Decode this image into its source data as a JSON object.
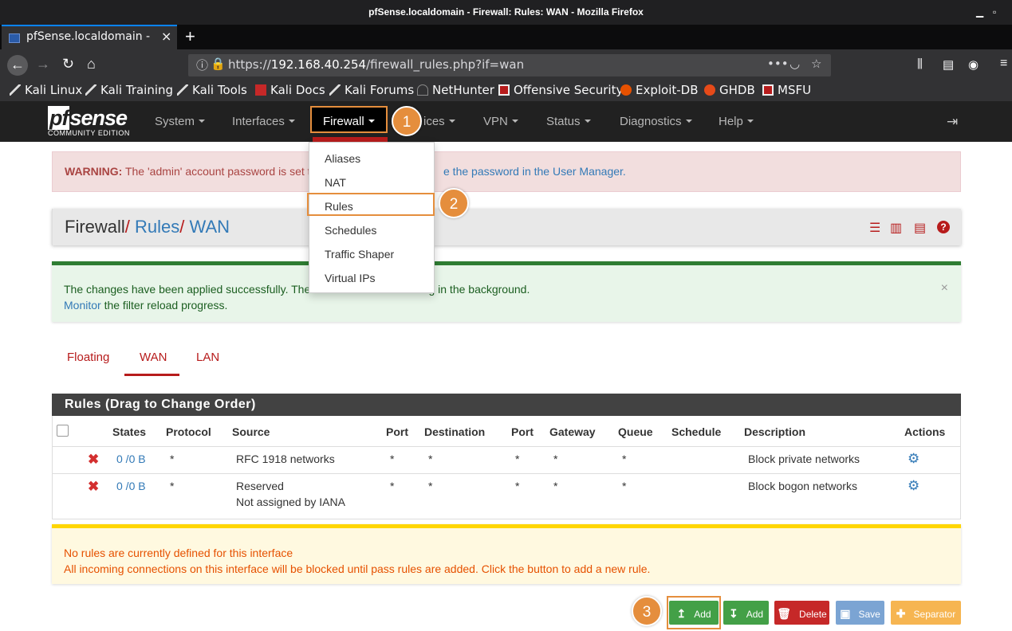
{
  "window": {
    "title": "pfSense.localdomain - Firewall: Rules: WAN - Mozilla Firefox"
  },
  "browser": {
    "tab_title": "pfSense.localdomain - Fi",
    "url_prefix": "https://",
    "url_host": "192.168.40.254",
    "url_path": "/firewall_rules.php?if=wan",
    "bookmarks": [
      "Kali Linux",
      "Kali Training",
      "Kali Tools",
      "Kali Docs",
      "Kali Forums",
      "NetHunter",
      "Offensive Security",
      "Exploit-DB",
      "GHDB",
      "MSFU"
    ]
  },
  "pf": {
    "logo_main": "pfsense",
    "logo_sub": "COMMUNITY EDITION",
    "menu": [
      "System",
      "Interfaces",
      "Firewall",
      "Services",
      "VPN",
      "Status",
      "Diagnostics",
      "Help"
    ],
    "services_partial": "ices"
  },
  "dropdown": [
    "Aliases",
    "NAT",
    "Rules",
    "Schedules",
    "Traffic Shaper",
    "Virtual IPs"
  ],
  "badges": [
    "1",
    "2",
    "3"
  ],
  "warning": {
    "label": "WARNING:",
    "text": " The 'admin' account password is set to",
    "link": "e the password in the User Manager."
  },
  "breadcrumb": {
    "root": "Firewall",
    "sep": "/",
    "l1": "Rules",
    "l2": "WAN"
  },
  "success": {
    "line1a": "The changes have been applied successfully. The f",
    "line1b": "ading in the background.",
    "link": "Monitor",
    "line2": " the filter reload progress."
  },
  "tabs": [
    "Floating",
    "WAN",
    "LAN"
  ],
  "panel_title": "Rules (Drag to Change Order)",
  "table": {
    "headers": [
      "States",
      "Protocol",
      "Source",
      "Port",
      "Destination",
      "Port",
      "Gateway",
      "Queue",
      "Schedule",
      "Description",
      "Actions"
    ],
    "rows": [
      {
        "states": "0 /0 B",
        "protocol": "*",
        "source": "RFC 1918 networks",
        "source2": "",
        "port": "*",
        "dest": "*",
        "dport": "*",
        "gateway": "*",
        "queue": "*",
        "schedule": "",
        "desc": "Block private networks"
      },
      {
        "states": "0 /0 B",
        "protocol": "*",
        "source": "Reserved",
        "source2": "Not assigned by IANA",
        "port": "*",
        "dest": "*",
        "dport": "*",
        "gateway": "*",
        "queue": "*",
        "schedule": "",
        "desc": "Block bogon networks"
      }
    ]
  },
  "notice": {
    "line1": "No rules are currently defined for this interface",
    "line2": "All incoming connections on this interface will be blocked until pass rules are added. Click the button to add a new rule."
  },
  "buttons": {
    "add_top": "Add",
    "add_bottom": "Add",
    "delete": "Delete",
    "save": "Save",
    "separator": "Separator"
  },
  "colors": {
    "accent": "#e58e3d",
    "pf_red": "#b71c1c",
    "link": "#337ab7",
    "success_btn": "#43a047",
    "danger_btn": "#c62828",
    "save_btn": "#7ba4d3",
    "separator_btn": "#f6b551"
  }
}
